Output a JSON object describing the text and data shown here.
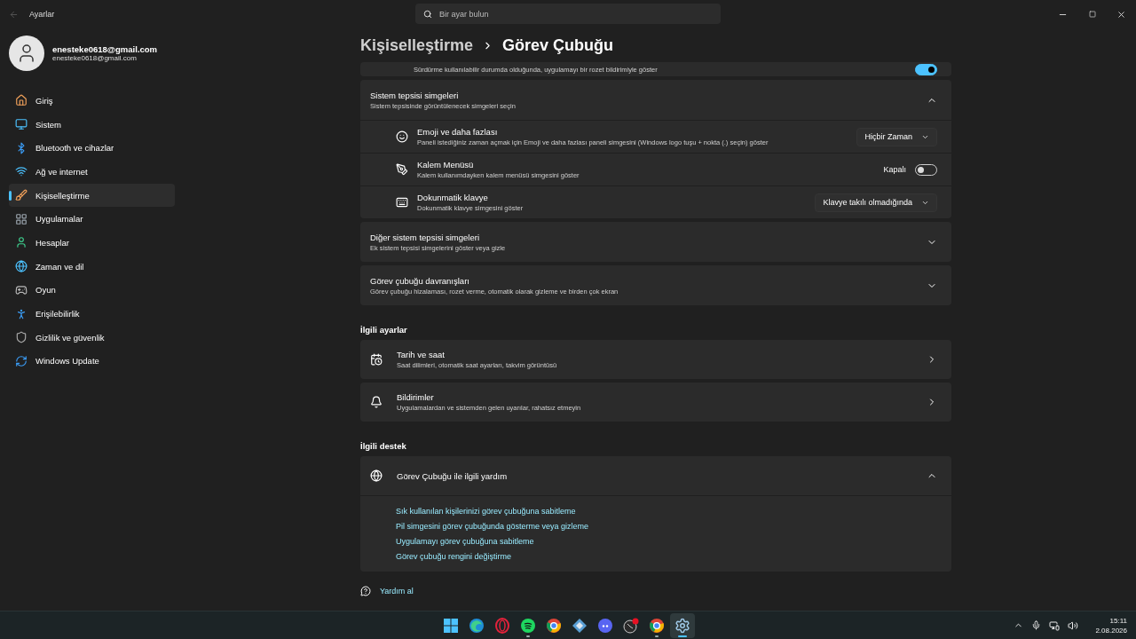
{
  "window": {
    "title": "Ayarlar"
  },
  "search": {
    "placeholder": "Bir ayar bulun"
  },
  "account": {
    "name": "enesteke0618@gmail.com",
    "email": "enesteke0618@gmail.com"
  },
  "sidebar": {
    "items": [
      {
        "kind": "home",
        "label": "Giriş",
        "selected": false
      },
      {
        "kind": "system",
        "label": "Sistem",
        "selected": false
      },
      {
        "kind": "bluetooth",
        "label": "Bluetooth ve cihazlar",
        "selected": false
      },
      {
        "kind": "network",
        "label": "Ağ ve internet",
        "selected": false
      },
      {
        "kind": "personalize",
        "label": "Kişiselleştirme",
        "selected": true
      },
      {
        "kind": "apps",
        "label": "Uygulamalar",
        "selected": false
      },
      {
        "kind": "accounts",
        "label": "Hesaplar",
        "selected": false
      },
      {
        "kind": "time",
        "label": "Zaman ve dil",
        "selected": false
      },
      {
        "kind": "gaming",
        "label": "Oyun",
        "selected": false
      },
      {
        "kind": "accessibility",
        "label": "Erişilebilirlik",
        "selected": false
      },
      {
        "kind": "privacy",
        "label": "Gizlilik ve güvenlik",
        "selected": false
      },
      {
        "kind": "update",
        "label": "Windows Update",
        "selected": false
      }
    ]
  },
  "breadcrumb": {
    "parent": "Kişiselleştirme",
    "current": "Görev Çubuğu"
  },
  "partial_row": {
    "description": "Sürdürme kullanılabilir durumda olduğunda, uygulamayı bir rozet bildirimiyle göster",
    "on": true
  },
  "groups": [
    {
      "title": "Sistem tepsisi simgeleri",
      "subtitle": "Sistem tepsisinde görüntülenecek simgeleri seçin",
      "expanded": true,
      "items": [
        {
          "kind": "dropdown",
          "title": "Emoji ve daha fazlası",
          "description": "Paneli istediğiniz zaman açmak için Emoji ve daha fazlası paneli simgesini (Windows logo tuşu + nokta (.) seçin) göster",
          "value": "Hiçbir Zaman"
        },
        {
          "kind": "toggle",
          "title": "Kalem Menüsü",
          "description": "Kalem kullanımdayken kalem menüsü simgesini göster",
          "state_label": "Kapalı",
          "on": false
        },
        {
          "kind": "dropdown",
          "title": "Dokunmatik klavye",
          "description": "Dokunmatik klavye simgesini göster",
          "value": "Klavye takılı olmadığında"
        }
      ]
    },
    {
      "title": "Diğer sistem tepsisi simgeleri",
      "subtitle": "Ek sistem tepsisi simgelerini göster veya gizle",
      "expanded": false
    },
    {
      "title": "Görev çubuğu davranışları",
      "subtitle": "Görev çubuğu hizalaması, rozet verme, otomatik olarak gizleme ve birden çok ekran",
      "expanded": false
    }
  ],
  "related_settings": {
    "heading": "İlgili ayarlar",
    "items": [
      {
        "title": "Tarih ve saat",
        "description": "Saat dilimleri, otomatik saat ayarları, takvim görüntüsü"
      },
      {
        "title": "Bildirimler",
        "description": "Uygulamalardan ve sistemden gelen uyarılar, rahatsız etmeyin"
      }
    ]
  },
  "related_support": {
    "heading": "İlgili destek",
    "title": "Görev Çubuğu ile ilgili yardım",
    "expanded": true,
    "links": [
      "Sık kullanılan kişilerinizi görev çubuğuna sabitleme",
      "Pil simgesini görev çubuğunda gösterme veya gizleme",
      "Uygulamayı görev çubuğuna sabitleme",
      "Görev çubuğu rengini değiştirme"
    ]
  },
  "get_help": "Yardım al",
  "taskbar": {
    "apps": [
      {
        "kind": "start",
        "running": false,
        "selected": false
      },
      {
        "kind": "edge",
        "running": false,
        "selected": false
      },
      {
        "kind": "opera",
        "running": false,
        "selected": false
      },
      {
        "kind": "spotify",
        "running": true,
        "selected": false
      },
      {
        "kind": "chrome",
        "running": false,
        "selected": false
      },
      {
        "kind": "diamond",
        "running": false,
        "selected": false
      },
      {
        "kind": "discord",
        "running": false,
        "selected": false
      },
      {
        "kind": "badge",
        "running": false,
        "selected": false
      },
      {
        "kind": "chrome2",
        "running": true,
        "selected": false
      },
      {
        "kind": "settings",
        "running": true,
        "selected": true
      }
    ],
    "time": "15:11",
    "date": "2.08.2026"
  }
}
